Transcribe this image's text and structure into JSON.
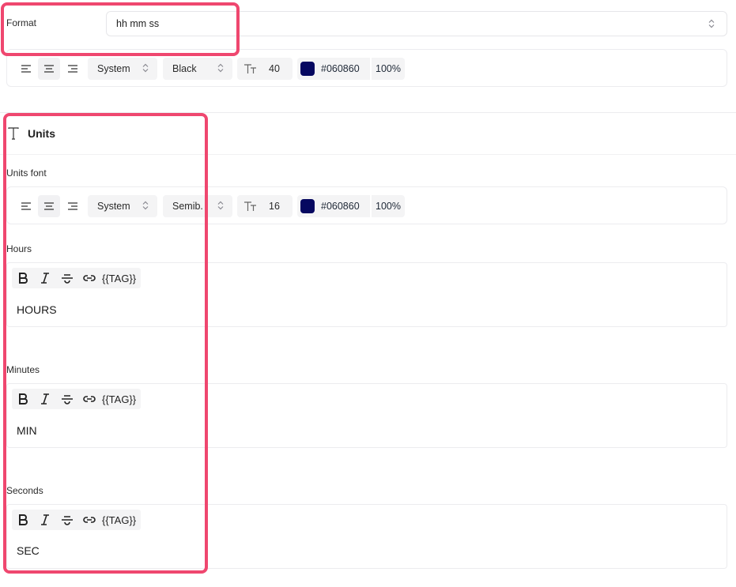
{
  "format": {
    "label": "Format",
    "value": "hh mm ss",
    "icon": "chevron-updown-icon"
  },
  "value_font": {
    "font_family": "System",
    "font_weight": "Black",
    "font_size": "40",
    "color_swatch": "#060860",
    "color_hex": "#060860",
    "opacity": "100%"
  },
  "units_section": {
    "title": "Units",
    "icon": "text-type-icon"
  },
  "units_font": {
    "label": "Units font",
    "font_family": "System",
    "font_weight": "Semib.",
    "font_size": "16",
    "color_swatch": "#060860",
    "color_hex": "#060860",
    "opacity": "100%"
  },
  "rich_toolbar": {
    "tag_label": "{{TAG}}"
  },
  "fields": {
    "hours": {
      "label": "Hours",
      "value": "HOURS"
    },
    "minutes": {
      "label": "Minutes",
      "value": "MIN"
    },
    "seconds": {
      "label": "Seconds",
      "value": "SEC"
    }
  },
  "colors": {
    "highlight": "#ef476f",
    "accent_swatch": "#060860"
  }
}
